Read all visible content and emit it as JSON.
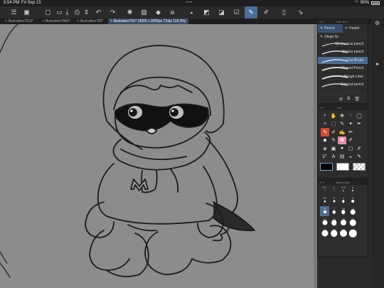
{
  "status_bar": {
    "time": "5:54 PM",
    "date": "Fri Sep 15",
    "battery": "90%"
  },
  "toolbar": {
    "icons": [
      "menu-icon",
      "logo-icon",
      "new-file-icon",
      "open-folder-icon",
      "save-icon",
      "print-icon",
      "settings-icon",
      "undo-icon",
      "redo-icon",
      "loading-icon",
      "fill-icon",
      "bucket-icon",
      "transform-icon",
      "select-icon",
      "select-alt-icon",
      "invert-icon",
      "check-icon",
      "pen-icon",
      "ruler-icon",
      "phone-icon",
      "snap-icon"
    ],
    "active": "pen-icon"
  },
  "tabs": [
    {
      "label": "Illustration7813*"
    },
    {
      "label": "Illustration7842*"
    },
    {
      "label": "Illustration789*"
    },
    {
      "label": "Illustration791* (3000 x 3000px 72dpi 116.3%)",
      "active": true
    }
  ],
  "sub_tool": {
    "header": "Sub Tool",
    "tabs": [
      {
        "label": "Pencil",
        "selected": true
      },
      {
        "label": "Pastel"
      }
    ],
    "group": "Diego Sc",
    "brushes": [
      {
        "label": "Mechanical pencil"
      },
      {
        "label": "Darker pencil"
      },
      {
        "label": "Fox Brush",
        "selected": true
      },
      {
        "label": "Flowed Pencil"
      },
      {
        "label": "Rough Liner"
      },
      {
        "label": "Colored pencil"
      }
    ]
  },
  "tool": {
    "header": "Tool"
  },
  "color": {
    "main": "#000000",
    "sub": "#ffffff"
  },
  "brush_size": {
    "header": "Brush Size",
    "values": [
      "0.7",
      "1",
      "1.5",
      "2",
      "",
      "2.5",
      "3",
      "4",
      "5",
      "",
      "6",
      "7",
      "10",
      "15",
      "",
      "17",
      "20",
      "25",
      "30",
      "",
      "40",
      "50",
      "60",
      "70",
      ""
    ],
    "selected": "6"
  }
}
